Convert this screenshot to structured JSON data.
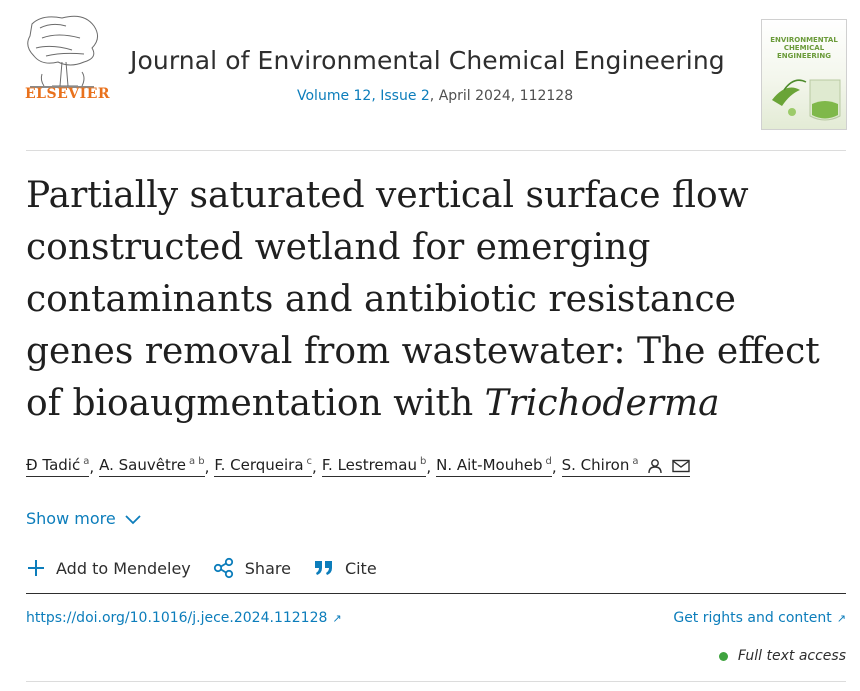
{
  "publisher": {
    "name": "ELSEVIER",
    "brand_color": "#e9711c"
  },
  "journal": {
    "name": "Journal of Environmental Chemical Engineering",
    "volume_issue": "Volume 12, Issue 2",
    "date_article": ", April 2024, 112128",
    "cover_text": "ENVIRONMENTAL CHEMICAL ENGINEERING"
  },
  "article": {
    "title_plain": "Partially saturated vertical surface flow constructed wetland for emerging contaminants and antibiotic resistance genes removal from wastewater: The effect of bioaugmentation with ",
    "title_italic": "Trichoderma"
  },
  "authors": [
    {
      "name": "Đ Tadić",
      "aff": "a"
    },
    {
      "name": "A. Sauvêtre",
      "aff": "a b"
    },
    {
      "name": "F. Cerqueira",
      "aff": "c"
    },
    {
      "name": "F. Lestremau",
      "aff": "b"
    },
    {
      "name": "N. Ait-Mouheb",
      "aff": "d"
    },
    {
      "name": "S. Chiron",
      "aff": "a"
    }
  ],
  "show_more": "Show more",
  "actions": {
    "mendeley": "Add to Mendeley",
    "share": "Share",
    "cite": "Cite"
  },
  "doi": "https://doi.org/10.1016/j.jece.2024.112128",
  "rights": "Get rights and content",
  "access": "Full text access",
  "colors": {
    "link": "#0c7dbb",
    "access_dot": "#3fa33f"
  },
  "icons": [
    "elsevier-tree-logo",
    "journal-cover",
    "person-icon",
    "envelope-icon",
    "chevron-down-icon",
    "plus-icon",
    "share-icon",
    "quote-icon",
    "external-arrow-icon"
  ]
}
